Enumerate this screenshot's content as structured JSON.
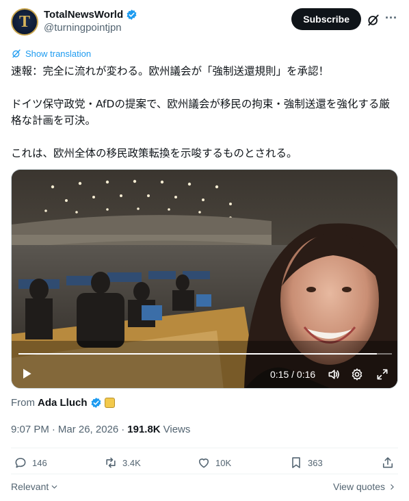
{
  "author": {
    "display_name": "TotalNewsWorld",
    "handle": "@turningpointjpn",
    "avatar_letter": "T",
    "verified": true
  },
  "header": {
    "subscribe_label": "Subscribe",
    "more_glyph": "···"
  },
  "translate": {
    "label": "Show translation"
  },
  "tweet": {
    "lines": [
      "速報：完全に流れが変わる。欧州議会が「強制送還規則」を承認！",
      "ドイツ保守政党・AfDの提案で、欧州議会が移民の拘束・強制送還を強化する厳格な計画を可決。",
      "これは、欧州全体の移民政策転換を示唆するものとされる。"
    ]
  },
  "video": {
    "current_time": "0:15",
    "duration": "0:16",
    "time_separator": " / ",
    "progress_fraction": 0.96
  },
  "attribution": {
    "from_label": "From",
    "source_name": "Ada Lluch"
  },
  "meta": {
    "time": "9:07 PM",
    "separator": "·",
    "date": "Mar 26, 2026",
    "views_count": "191.8K",
    "views_label": "Views"
  },
  "actions": {
    "replies": "146",
    "reposts": "3.4K",
    "likes": "10K",
    "bookmarks": "363"
  },
  "footer": {
    "relevant_label": "Relevant",
    "view_quotes_label": "View quotes"
  },
  "colors": {
    "accent": "#1d9bf0",
    "text_primary": "#0f1419",
    "text_secondary": "#536471",
    "subscribe_bg": "#0f1419"
  }
}
